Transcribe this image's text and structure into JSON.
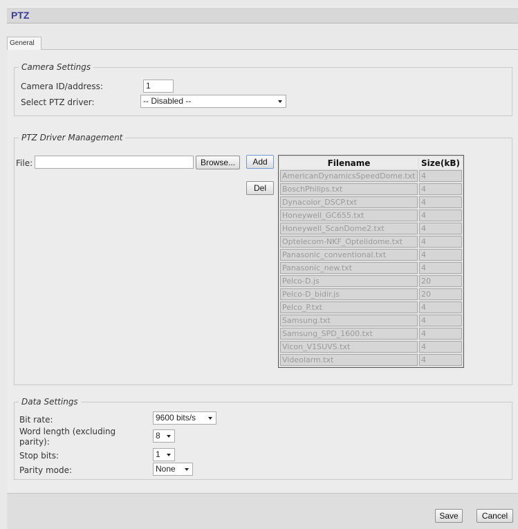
{
  "window": {
    "title": "PTZ"
  },
  "tabs": [
    {
      "label": "General"
    }
  ],
  "camera_settings": {
    "legend": "Camera Settings",
    "camera_id_label": "Camera ID/address:",
    "camera_id_value": "1",
    "ptz_driver_label": "Select PTZ driver:",
    "ptz_driver_value": "-- Disabled --"
  },
  "driver_management": {
    "legend": "PTZ Driver Management",
    "file_label": "File:",
    "browse_label": "Browse...",
    "add_label": "Add",
    "del_label": "Del",
    "columns": {
      "filename": "Filename",
      "size": "Size(kB)"
    },
    "files": [
      {
        "name": "AmericanDynamicsSpeedDome.txt",
        "size": "4"
      },
      {
        "name": "BoschPhilips.txt",
        "size": "4"
      },
      {
        "name": "Dynacolor_DSCP.txt",
        "size": "4"
      },
      {
        "name": "Honeywell_GC655.txt",
        "size": "4"
      },
      {
        "name": "Honeywell_ScanDome2.txt",
        "size": "4"
      },
      {
        "name": "Optelecom-NKF_Optelidome.txt",
        "size": "4"
      },
      {
        "name": "Panasonic_conventional.txt",
        "size": "4"
      },
      {
        "name": "Panasonic_new.txt",
        "size": "4"
      },
      {
        "name": "Pelco-D.js",
        "size": "20"
      },
      {
        "name": "Pelco-D_bidir.js",
        "size": "20"
      },
      {
        "name": "Pelco_P.txt",
        "size": "4"
      },
      {
        "name": "Samsung.txt",
        "size": "4"
      },
      {
        "name": "Samsung_SPD_1600.txt",
        "size": "4"
      },
      {
        "name": "Vicon_V1SUVS.txt",
        "size": "4"
      },
      {
        "name": "Videolarm.txt",
        "size": "4"
      }
    ]
  },
  "data_settings": {
    "legend": "Data Settings",
    "bit_rate_label": "Bit rate:",
    "bit_rate_value": "9600 bits/s",
    "word_length_label_line1": "Word length (excluding",
    "word_length_label_line2": "parity):",
    "word_length_value": "8",
    "stop_bits_label": "Stop bits:",
    "stop_bits_value": "1",
    "parity_label": "Parity mode:",
    "parity_value": "None"
  },
  "footer": {
    "save_label": "Save",
    "cancel_label": "Cancel"
  }
}
